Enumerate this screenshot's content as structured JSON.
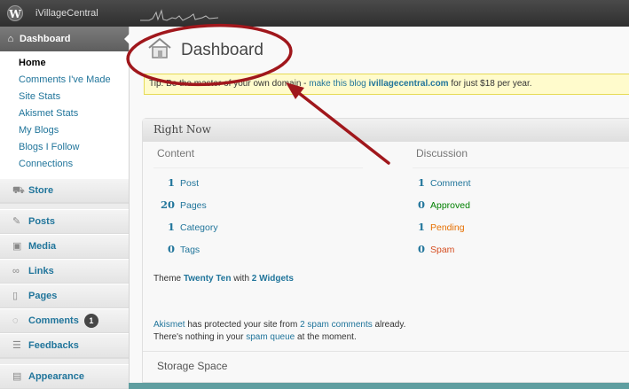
{
  "adminbar": {
    "wp_logo": "W",
    "site_name": "iVillageCentral"
  },
  "menu": {
    "dashboard_label": "Dashboard",
    "submenu": [
      "Home",
      "Comments I've Made",
      "Site Stats",
      "Akismet Stats",
      "My Blogs",
      "Blogs I Follow",
      "Connections"
    ],
    "items": [
      {
        "label": "Store",
        "icon": "cart-icon"
      },
      {
        "label": "Posts",
        "icon": "pin-icon"
      },
      {
        "label": "Media",
        "icon": "media-icon"
      },
      {
        "label": "Links",
        "icon": "link-icon"
      },
      {
        "label": "Pages",
        "icon": "pages-icon"
      },
      {
        "label": "Comments",
        "icon": "comment-icon",
        "badge": "1"
      },
      {
        "label": "Feedbacks",
        "icon": "feedback-icon"
      },
      {
        "label": "Appearance",
        "icon": "appearance-icon"
      }
    ]
  },
  "main": {
    "title": "Dashboard",
    "tip": {
      "prefix": "Tip: Be the master of your own domain - ",
      "link": "make this blog ",
      "domain": "ivillagecentral.com",
      "suffix": " for just $18 per year."
    },
    "right_now": {
      "title": "Right Now",
      "content_head": "Content",
      "discussion_head": "Discussion",
      "content": [
        {
          "num": "1",
          "label": "Post"
        },
        {
          "num": "20",
          "label": "Pages"
        },
        {
          "num": "1",
          "label": "Category"
        },
        {
          "num": "0",
          "label": "Tags"
        }
      ],
      "discussion": [
        {
          "num": "1",
          "label": "Comment"
        },
        {
          "num": "0",
          "label": "Approved"
        },
        {
          "num": "1",
          "label": "Pending"
        },
        {
          "num": "0",
          "label": "Spam"
        }
      ],
      "theme": {
        "prefix": "Theme ",
        "name": "Twenty Ten",
        "mid": " with ",
        "widgets": "2 Widgets"
      },
      "akismet": {
        "name": "Akismet",
        "mid": " has protected your site from ",
        "link": "2 spam comments",
        "suffix": " already."
      },
      "queue": {
        "prefix": "There's nothing in your ",
        "link": "spam queue",
        "suffix": " at the moment."
      },
      "storage_title": "Storage Space"
    }
  },
  "colors": {
    "link": "#21759b",
    "approved": "#008000",
    "pending": "#e66f00",
    "spam": "#d54e21",
    "annotation": "#a0171c"
  }
}
